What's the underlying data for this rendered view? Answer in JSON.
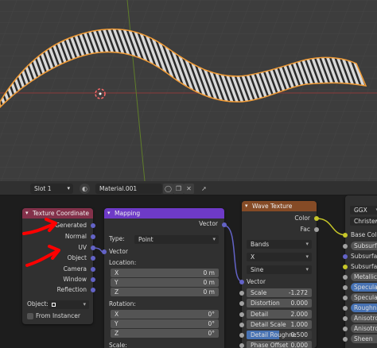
{
  "colors": {
    "selection_outline": "#f29c36",
    "vector_socket": "#6363c7",
    "color_socket": "#c7c729",
    "float_socket": "#a1a1a1",
    "texcoord_header": "#83314a",
    "mapping_header": "#6e3ac7",
    "wave_header": "#854b26",
    "annotation_arrow": "#ff0000",
    "active_field": "#4772b3"
  },
  "header": {
    "slot": "Slot 1",
    "material": "Material.001"
  },
  "texture_coordinate": {
    "title": "Texture Coordinate",
    "outputs": [
      "Generated",
      "Normal",
      "UV",
      "Object",
      "Camera",
      "Window",
      "Reflection"
    ],
    "object_label": "Object:",
    "from_instancer": "From Instancer"
  },
  "mapping": {
    "title": "Mapping",
    "output": "Vector",
    "type_label": "Type:",
    "type_value": "Point",
    "vector_label": "Vector",
    "location_label": "Location:",
    "location": [
      {
        "axis": "X",
        "value": "0 m"
      },
      {
        "axis": "Y",
        "value": "0 m"
      },
      {
        "axis": "Z",
        "value": "0 m"
      }
    ],
    "rotation_label": "Rotation:",
    "rotation": [
      {
        "axis": "X",
        "value": "0°"
      },
      {
        "axis": "Y",
        "value": "0°"
      },
      {
        "axis": "Z",
        "value": "0°"
      }
    ],
    "scale_label": "Scale:"
  },
  "wave_texture": {
    "title": "Wave Texture",
    "outputs": [
      "Color",
      "Fac"
    ],
    "wave_type": "Bands",
    "direction": "X",
    "profile": "Sine",
    "vector_label": "Vector",
    "params": [
      {
        "label": "Scale",
        "value": "-1.272"
      },
      {
        "label": "Distortion",
        "value": "0.000"
      },
      {
        "label": "Detail",
        "value": "2.000"
      },
      {
        "label": "Detail Scale",
        "value": "1.000"
      },
      {
        "label": "Detail Roughne",
        "value": "0.500"
      },
      {
        "label": "Phase Offset",
        "value": "0.000"
      }
    ]
  },
  "bsdf": {
    "distribution": "GGX",
    "subsurface_method": "Christensen",
    "inputs": [
      "Base Color",
      "Subsurface",
      "Subsurface R",
      "Subsurface C",
      "Metallic",
      "Specular",
      "Specular Ti",
      "Roughness",
      "Anisotropic",
      "Anisotropic",
      "Sheen"
    ]
  }
}
